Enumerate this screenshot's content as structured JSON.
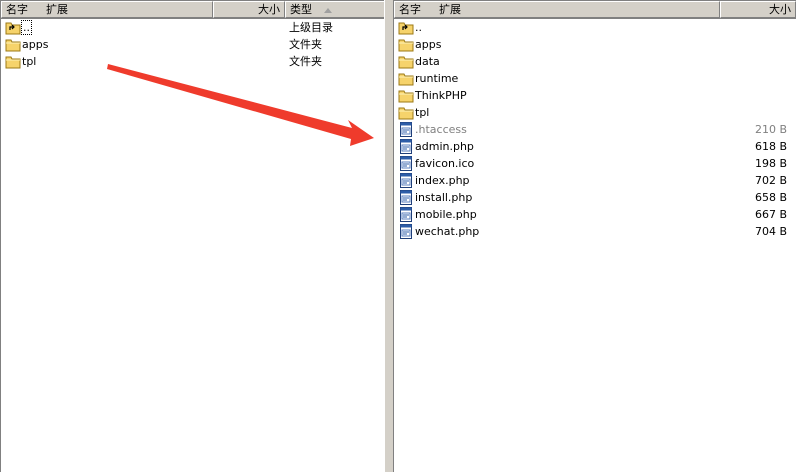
{
  "left_pane": {
    "headers": {
      "name": "名字",
      "ext": "扩展",
      "size": "大小",
      "type": "类型"
    },
    "rows": [
      {
        "name": "..",
        "type": "上级目录",
        "icon": "folder-up-icon"
      },
      {
        "name": "apps",
        "type": "文件夹",
        "icon": "folder-icon"
      },
      {
        "name": "tpl",
        "type": "文件夹",
        "icon": "folder-icon"
      }
    ]
  },
  "right_pane": {
    "headers": {
      "name": "名字",
      "ext": "扩展",
      "size": "大小"
    },
    "rows": [
      {
        "name": "..",
        "size": "",
        "icon": "folder-up-icon"
      },
      {
        "name": "apps",
        "size": "",
        "icon": "folder-icon"
      },
      {
        "name": "data",
        "size": "",
        "icon": "folder-icon"
      },
      {
        "name": "runtime",
        "size": "",
        "icon": "folder-icon"
      },
      {
        "name": "ThinkPHP",
        "size": "",
        "icon": "folder-icon"
      },
      {
        "name": "tpl",
        "size": "",
        "icon": "folder-icon"
      },
      {
        "name": ".htaccess",
        "size": "210 B",
        "icon": "file-icon",
        "hidden": true
      },
      {
        "name": "admin.php",
        "size": "618 B",
        "icon": "file-icon"
      },
      {
        "name": "favicon.ico",
        "size": "198 B",
        "icon": "file-icon"
      },
      {
        "name": "index.php",
        "size": "702 B",
        "icon": "file-icon"
      },
      {
        "name": "install.php",
        "size": "658 B",
        "icon": "file-icon"
      },
      {
        "name": "mobile.php",
        "size": "667 B",
        "icon": "file-icon"
      },
      {
        "name": "wechat.php",
        "size": "704 B",
        "icon": "file-icon"
      }
    ]
  },
  "colors": {
    "arrow": "#ef3b2c",
    "pane_bg": "#ffffff",
    "chrome": "#d4d0c8",
    "folder": "#f6d36b"
  }
}
